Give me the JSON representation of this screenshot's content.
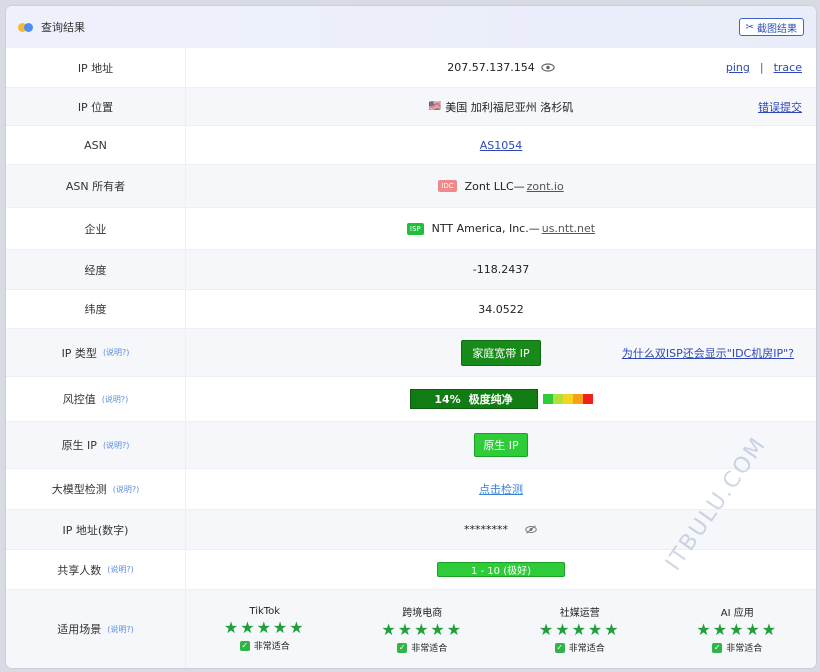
{
  "header": {
    "title": "查询结果",
    "screenshot_label": "截图结果"
  },
  "rows": {
    "ip": {
      "label": "IP 地址",
      "value": "207.57.137.154",
      "ping": "ping",
      "separator": "|",
      "trace": "trace"
    },
    "location": {
      "label": "IP 位置",
      "flag": "🇺🇸",
      "value": "美国 加利福尼亚州 洛杉矶",
      "report": "错误提交"
    },
    "asn": {
      "label": "ASN",
      "value": "AS1054"
    },
    "asn_owner": {
      "label": "ASN 所有者",
      "tag": "IDC",
      "name": "Zont LLC",
      "dash": "—",
      "domain": "zont.io"
    },
    "enterprise": {
      "label": "企业",
      "tag": "ISP",
      "name": "NTT America, Inc.",
      "dash": "—",
      "domain": "us.ntt.net"
    },
    "longitude": {
      "label": "经度",
      "value": "-118.2437"
    },
    "latitude": {
      "label": "纬度",
      "value": "34.0522"
    },
    "ip_type": {
      "label": "IP 类型",
      "help": "(说明?)",
      "value": "家庭宽带 IP",
      "question": "为什么双ISP还会显示\"IDC机房IP\"?"
    },
    "risk": {
      "label": "风控值",
      "help": "(说明?)",
      "percent": "14%",
      "text": "极度纯净",
      "level": 0.14
    },
    "native": {
      "label": "原生 IP",
      "help": "(说明?)",
      "value": "原生 IP"
    },
    "llm": {
      "label": "大模型检测",
      "help": "(说明?)",
      "value": "点击检测"
    },
    "ip_numeric": {
      "label": "IP 地址(数字)",
      "value": "********"
    },
    "share": {
      "label": "共享人数",
      "help": "(说明?)",
      "value": "1 - 10 (极好)"
    },
    "scenes": {
      "label": "适用场景",
      "help": "(说明?)",
      "items": [
        {
          "name": "TikTok",
          "stars": "★★★★★",
          "fit": "非常适合"
        },
        {
          "name": "跨境电商",
          "stars": "★★★★★",
          "fit": "非常适合"
        },
        {
          "name": "社媒运营",
          "stars": "★★★★★",
          "fit": "非常适合"
        },
        {
          "name": "AI 应用",
          "stars": "★★★★★",
          "fit": "非常适合"
        }
      ]
    }
  },
  "watermark": "ITBULU.COM",
  "colors": {
    "accent": "#2f46b5",
    "green_dark": "#188a1a",
    "green": "#2fcc3a",
    "star": "#20a03a"
  }
}
